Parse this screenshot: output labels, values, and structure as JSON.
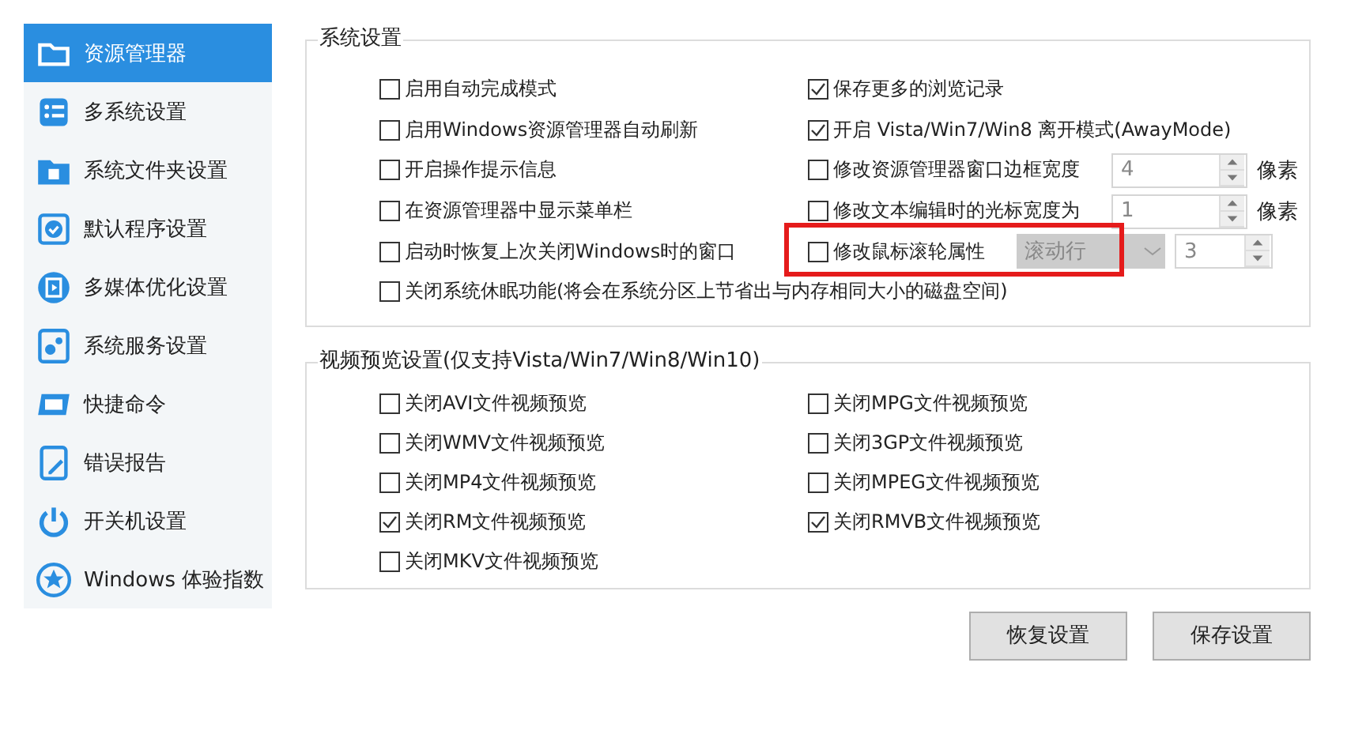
{
  "sidebar": {
    "items": [
      {
        "label": "资源管理器",
        "selected": true
      },
      {
        "label": "多系统设置",
        "selected": false
      },
      {
        "label": "系统文件夹设置",
        "selected": false
      },
      {
        "label": "默认程序设置",
        "selected": false
      },
      {
        "label": "多媒体优化设置",
        "selected": false
      },
      {
        "label": "系统服务设置",
        "selected": false
      },
      {
        "label": "快捷命令",
        "selected": false
      },
      {
        "label": "错误报告",
        "selected": false
      },
      {
        "label": "开关机设置",
        "selected": false
      },
      {
        "label": "Windows 体验指数",
        "selected": false
      }
    ]
  },
  "system_settings": {
    "title": "系统设置",
    "left": [
      {
        "label": "启用自动完成模式",
        "checked": false
      },
      {
        "label": "启用Windows资源管理器自动刷新",
        "checked": false
      },
      {
        "label": "开启操作提示信息",
        "checked": false
      },
      {
        "label": "在资源管理器中显示菜单栏",
        "checked": false
      },
      {
        "label": "启动时恢复上次关闭Windows时的窗口",
        "checked": false
      },
      {
        "label": "关闭系统休眠功能(将会在系统分区上节省出与内存相同大小的磁盘空间)",
        "checked": false
      }
    ],
    "right": [
      {
        "kind": "check",
        "label": "保存更多的浏览记录",
        "checked": true
      },
      {
        "kind": "check",
        "label": "开启 Vista/Win7/Win8 离开模式(AwayMode)",
        "checked": true
      },
      {
        "kind": "spin",
        "label": "修改资源管理器窗口边框宽度",
        "checked": false,
        "value": "4",
        "unit": "像素"
      },
      {
        "kind": "spin",
        "label": "修改文本编辑时的光标宽度为",
        "checked": false,
        "value": "1",
        "unit": "像素"
      },
      {
        "kind": "combo",
        "label": "修改鼠标滚轮属性",
        "checked": false,
        "combo": "滚动行",
        "value": "3",
        "highlighted": true
      }
    ]
  },
  "video_preview": {
    "title": "视频预览设置(仅支持Vista/Win7/Win8/Win10)",
    "items": [
      {
        "label": "关闭AVI文件视频预览",
        "checked": false
      },
      {
        "label": "关闭MPG文件视频预览",
        "checked": false
      },
      {
        "label": "关闭WMV文件视频预览",
        "checked": false
      },
      {
        "label": "关闭3GP文件视频预览",
        "checked": false
      },
      {
        "label": "关闭MP4文件视频预览",
        "checked": false
      },
      {
        "label": "关闭MPEG文件视频预览",
        "checked": false
      },
      {
        "label": "关闭RM文件视频预览",
        "checked": true
      },
      {
        "label": "关闭RMVB文件视频预览",
        "checked": true
      },
      {
        "label": "关闭MKV文件视频预览",
        "checked": false
      }
    ]
  },
  "buttons": [
    "恢复设置",
    "保存设置"
  ]
}
